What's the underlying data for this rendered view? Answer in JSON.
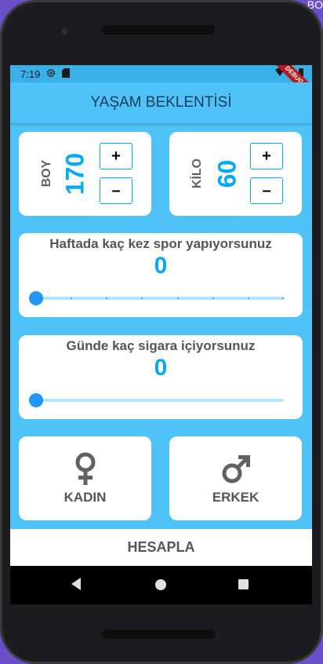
{
  "desktop": {
    "corner_text": "BO"
  },
  "status_bar": {
    "time": "7:19",
    "settings_icon": "gear-icon",
    "sd_icon": "sd-card-icon",
    "wifi_icon": "wifi-icon",
    "battery_icon": "battery-icon"
  },
  "debug_banner": "DEBUG",
  "app_bar": {
    "title": "YAŞAM BEKLENTİSİ"
  },
  "height_card": {
    "label": "BOY",
    "value": "170",
    "plus": "+",
    "minus": "–"
  },
  "weight_card": {
    "label": "KİLO",
    "value": "60",
    "plus": "+",
    "minus": "–"
  },
  "sport_card": {
    "question": "Haftada kaç kez spor yapıyorsunuz",
    "value": "0",
    "slider_min": 0,
    "slider_max": 7,
    "slider_value": 0
  },
  "smoke_card": {
    "question": "Günde kaç sigara içiyorsunuz",
    "value": "0",
    "slider_value": 0
  },
  "gender": {
    "female": {
      "label": "KADIN",
      "icon": "female-symbol-icon"
    },
    "male": {
      "label": "ERKEK",
      "icon": "male-symbol-icon"
    }
  },
  "calculate_button": "HESAPLA",
  "nav": {
    "back": "back-icon",
    "home": "home-icon",
    "recents": "recents-icon"
  },
  "colors": {
    "accent": "#03a9f4",
    "background": "#4fc3f7",
    "text": "#555555"
  }
}
